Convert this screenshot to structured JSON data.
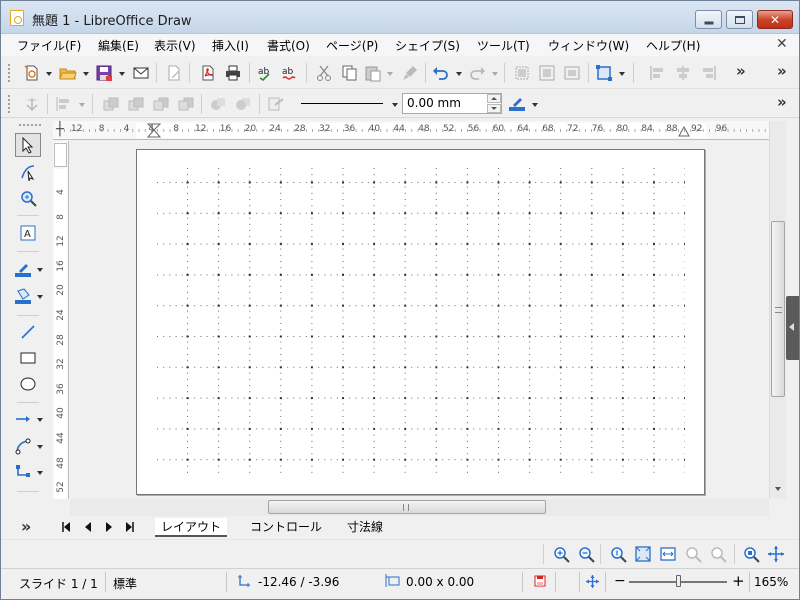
{
  "window": {
    "title": "無題 1 - LibreOffice Draw",
    "controls": {
      "minimize": "",
      "maximize": "",
      "close": "✕"
    }
  },
  "menu": {
    "items": [
      {
        "label": "ファイル(F)"
      },
      {
        "label": "編集(E)"
      },
      {
        "label": "表示(V)"
      },
      {
        "label": "挿入(I)"
      },
      {
        "label": "書式(O)"
      },
      {
        "label": "ページ(P)"
      },
      {
        "label": "シェイプ(S)"
      },
      {
        "label": "ツール(T)"
      },
      {
        "label": "ウィンドウ(W)"
      },
      {
        "label": "ヘルプ(H)"
      }
    ],
    "close_glyph": "✕"
  },
  "toolbar": {
    "more_glyph": "»",
    "line_width_value": "0.00 mm"
  },
  "rulers": {
    "horizontal_ticks": [
      "12",
      "8",
      "4",
      "4",
      "8",
      "12",
      "16",
      "20",
      "24",
      "28",
      "32",
      "36",
      "40",
      "44",
      "48",
      "52",
      "56",
      "60",
      "64",
      "68",
      "72",
      "76",
      "80",
      "84",
      "88",
      "92",
      "96"
    ],
    "vertical_ticks": [
      "4",
      "8",
      "12",
      "16",
      "20",
      "24",
      "28",
      "32",
      "36",
      "40",
      "44",
      "48",
      "52"
    ]
  },
  "tabs": {
    "more_glyph": "»",
    "items": [
      {
        "label": "レイアウト",
        "active": true
      },
      {
        "label": "コントロール",
        "active": false
      },
      {
        "label": "寸法線",
        "active": false
      }
    ]
  },
  "statusbar": {
    "slide": "スライド 1 / 1",
    "layout": "標準",
    "position": "-12.46 / -3.96",
    "size": "0.00 x 0.00",
    "zoom_minus": "−",
    "zoom_plus": "+",
    "zoom": "165%",
    "zoom_level": 0.5
  },
  "colors": {
    "accent_blue": "#2a6fc9",
    "orange": "#e07a1f",
    "title_gradient_top": "#dbe6f3"
  }
}
